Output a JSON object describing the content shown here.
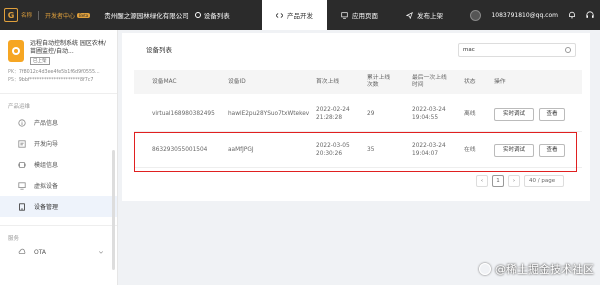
{
  "topbar": {
    "logo_text": "名称",
    "dev_center": "开发者中心",
    "beta": "Beta",
    "company": "贵州醒之源园林绿化有限公司",
    "devices_list": "设备列表",
    "tabs": [
      {
        "label": "产品开发",
        "active": true
      },
      {
        "label": "应用页面",
        "active": false
      },
      {
        "label": "发布上架",
        "active": false
      }
    ],
    "email": "1083791810@qq.com"
  },
  "sidebar": {
    "project_title": "远程自动控制系统 园区农林/苗圃监控/自动...",
    "project_tag": "已上架",
    "pk_label": "PK：",
    "pk_value": "7f8012c4d3ee4fe5b1f6d9f0555...",
    "ps_label": "PS：",
    "ps_value": "9bbf*********************8f7c7",
    "section_manage": "产品运维",
    "items": [
      {
        "label": "产品信息",
        "icon": "info-icon",
        "active": false
      },
      {
        "label": "开发向导",
        "icon": "guide-icon",
        "active": false
      },
      {
        "label": "模组信息",
        "icon": "module-icon",
        "active": false
      },
      {
        "label": "虚拟设备",
        "icon": "virtual-device-icon",
        "active": false
      },
      {
        "label": "设备管理",
        "icon": "device-manage-icon",
        "active": true
      }
    ],
    "section_service": "服务",
    "ota_label": "OTA"
  },
  "main": {
    "title": "设备列表",
    "search_value": "mac",
    "columns": [
      "设备MAC",
      "设备ID",
      "首次上线",
      "累计上线次数",
      "最后一次上线时间",
      "状态",
      "操作"
    ],
    "rows": [
      {
        "mac": "virtual168980382495",
        "id": "hawlE2pu28YSuo7txWtekev",
        "first_online": "2022-02-24 21:28:28",
        "count": "29",
        "last_online": "2022-03-24 19:04:55",
        "status": "离线",
        "btn_realtime": "实时调试",
        "btn_view": "查看"
      },
      {
        "mac": "863293055001504",
        "id": "aaMfJPGJ",
        "first_online": "2022-03-05 20:30:26",
        "count": "35",
        "last_online": "2022-03-24 19:04:07",
        "status": "在线",
        "btn_realtime": "实时调试",
        "btn_view": "查看"
      }
    ],
    "pager": {
      "prev": "‹",
      "page": "1",
      "next": "›",
      "size": "40 / page"
    }
  },
  "watermark": "@稀土掘金技术社区",
  "colors": {
    "topbar_bg": "#2b2b2b",
    "accent": "#e0a03c",
    "highlight": "#e02020"
  }
}
